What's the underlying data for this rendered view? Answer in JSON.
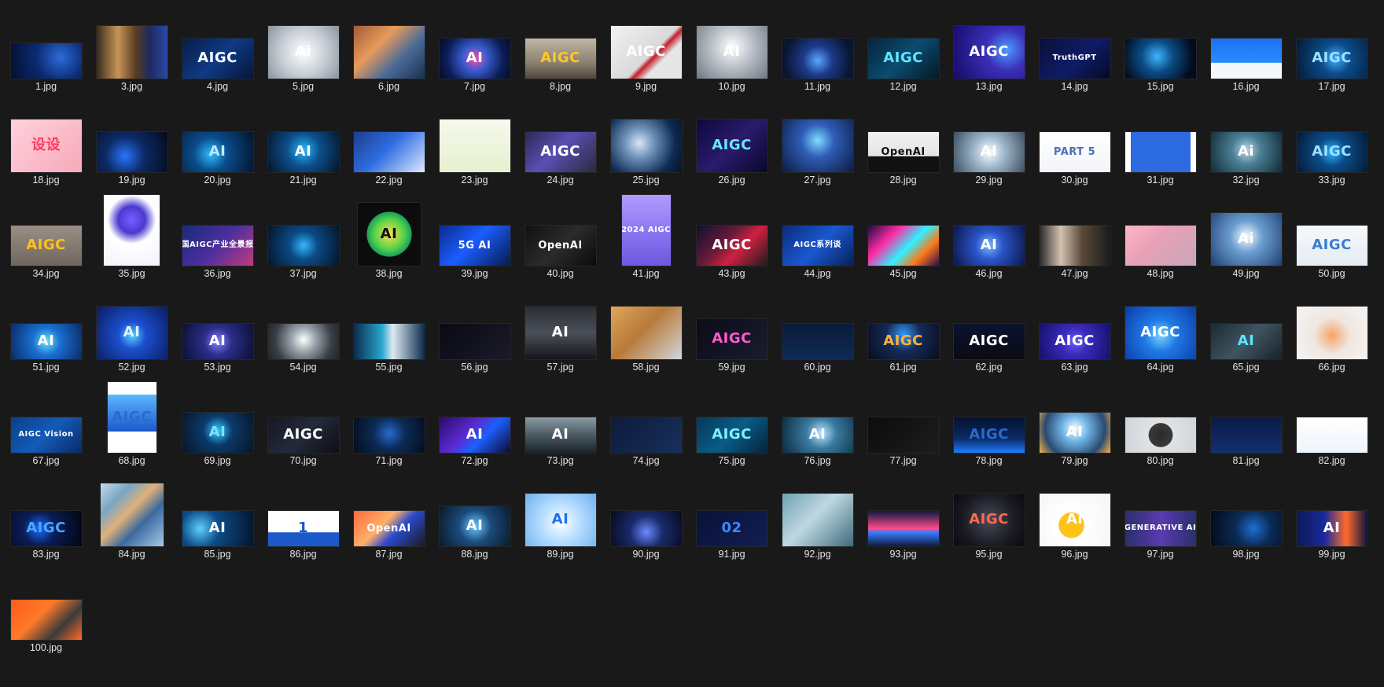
{
  "window": {
    "background": "#191919"
  },
  "tiles": [
    {
      "name": "1.jpg",
      "text": "",
      "fg": "#9cc4ff",
      "bg": "radial-gradient(circle at 70% 40%, #2c6cd9 0%, #0b2a72 45%, #03102e 100%)"
    },
    {
      "name": "3.jpg",
      "text": "",
      "fg": "#ffffff",
      "bg": "linear-gradient(90deg, #3a2a1a 0%, #c79558 30%, #5a3c22 55%, #1c2a5e 75%, #2b4aa8 100%)"
    },
    {
      "name": "4.jpg",
      "text": "AIGC",
      "fg": "#ffffff",
      "bg": "linear-gradient(135deg, #071c44 0%, #0f3a86 50%, #06163a 100%)"
    },
    {
      "name": "5.jpg",
      "text": "Ai",
      "fg": "#ffffff",
      "bg": "radial-gradient(circle at 50% 50%, #ffffff 0%, #c9cfd6 50%, #8a949e 100%)"
    },
    {
      "name": "6.jpg",
      "text": "",
      "fg": "#ffffff",
      "bg": "linear-gradient(135deg, #a45a3a 0%, #e79a5a 35%, #4a6a98 65%, #18304f 100%)"
    },
    {
      "name": "7.jpg",
      "text": "AI",
      "fg": "#ffffff",
      "bg": "radial-gradient(circle at 50% 50%, #ff4da6 0%, #3a5bd0 30%, #0a1d55 70%, #040c26 100%)"
    },
    {
      "name": "8.jpg",
      "text": "AIGC",
      "fg": "#ffc823",
      "bg": "linear-gradient(180deg, #bfb6a6 0%, #8c8170 60%, #4e463c 100%)"
    },
    {
      "name": "9.jpg",
      "text": "AIGC",
      "fg": "#ffffff",
      "bg": "linear-gradient(135deg, #f2f2f2 0%, #d9d9d9 55%, #c41e2a 60%, #e6e6e6 70%)"
    },
    {
      "name": "10.jpg",
      "text": "AI",
      "fg": "#ffffff",
      "bg": "radial-gradient(circle at 50% 40%, #ffffff 0%, #b8bec6 45%, #6e767f 100%)"
    },
    {
      "name": "11.jpg",
      "text": "",
      "fg": "#ffffff",
      "bg": "radial-gradient(circle at 50% 55%, #58a8ff 0%, #1d3a8a 35%, #0a1530 80%)"
    },
    {
      "name": "12.jpg",
      "text": "AIGC",
      "fg": "#5ee7ff",
      "bg": "linear-gradient(135deg, #06243c 0%, #0b4c70 50%, #041826 100%)"
    },
    {
      "name": "13.jpg",
      "text": "AIGC",
      "fg": "#ffffff",
      "bg": "radial-gradient(circle at 75% 45%, #4d9bff 0%, #3a2fb8 35%, #160a66 100%)"
    },
    {
      "name": "14.jpg",
      "text": "TruthGPT",
      "fg": "#ffffff",
      "bg": "linear-gradient(135deg, #0a0f3a 0%, #0e1c66 55%, #050a26 100%)"
    },
    {
      "name": "15.jpg",
      "text": "",
      "fg": "#ffffff",
      "bg": "radial-gradient(circle at 45% 45%, #3fb6ff 0%, #0b4c86 35%, #030c1e 80%)"
    },
    {
      "name": "16.jpg",
      "text": "",
      "fg": "#ffffff",
      "bg": "linear-gradient(180deg, #1d6ff2 0%, #2a8cff 60%, #f5f7fb 61%, #f5f7fb 100%)"
    },
    {
      "name": "17.jpg",
      "text": "AIGC",
      "fg": "#9fe0ff",
      "bg": "radial-gradient(circle at 55% 50%, #3fb0ff 0%, #0c4b8a 35%, #041a33 100%)"
    },
    {
      "name": "18.jpg",
      "text": "设设",
      "fg": "#ff3b5c",
      "bg": "linear-gradient(135deg, #ffd1dc 0%, #f7aabb 100%)"
    },
    {
      "name": "19.jpg",
      "text": "",
      "fg": "#ffffff",
      "bg": "radial-gradient(circle at 40% 60%, #2a74ff 0%, #0c2a66 40%, #040a1a 100%)"
    },
    {
      "name": "20.jpg",
      "text": "AI",
      "fg": "#bfe8ff",
      "bg": "radial-gradient(circle at 40% 55%, #2fbfff 0%, #0a4d8c 35%, #031329 100%)"
    },
    {
      "name": "21.jpg",
      "text": "AI",
      "fg": "#ffffff",
      "bg": "radial-gradient(circle at 50% 45%, #2bb6ff 0%, #0d4f8c 40%, #041427 100%)"
    },
    {
      "name": "22.jpg",
      "text": "",
      "fg": "#ffffff",
      "bg": "linear-gradient(135deg, #1d3d8f 0%, #2e6de0 45%, #dfe9ff 100%)"
    },
    {
      "name": "23.jpg",
      "text": "",
      "fg": "#333333",
      "bg": "linear-gradient(180deg, #f6f9ec 0%, #e6f0cf 100%)"
    },
    {
      "name": "24.jpg",
      "text": "AIGC",
      "fg": "#ffffff",
      "bg": "linear-gradient(135deg, #2b2a55 0%, #5a4fb3 45%, #2a2a3a 100%)"
    },
    {
      "name": "25.jpg",
      "text": "",
      "fg": "#ffffff",
      "bg": "radial-gradient(circle at 40% 45%, #d8e6f2 0%, #6b8fb6 30%, #0d2a52 70%, #061325 100%)"
    },
    {
      "name": "26.jpg",
      "text": "AIGC",
      "fg": "#68e6ff",
      "bg": "linear-gradient(135deg, #0b0a3a 0%, #2b1a6d 50%, #08082a 100%)"
    },
    {
      "name": "27.jpg",
      "text": "",
      "fg": "#ffffff",
      "bg": "radial-gradient(circle at 50% 40%, #7ddcff 0%, #2f5db8 35%, #0b1a3e 100%)"
    },
    {
      "name": "28.jpg",
      "text": "OpenAI",
      "fg": "#111111",
      "bg": "linear-gradient(180deg, #f2f2f2 0%, #e4e4e4 60%, #111111 61%, #111111 100%)"
    },
    {
      "name": "29.jpg",
      "text": "AI",
      "fg": "#ffffff",
      "bg": "radial-gradient(circle at 50% 50%, #ffffff 0%, #9ab4c8 40%, #3d4e5e 100%)"
    },
    {
      "name": "30.jpg",
      "text": "PART 5",
      "fg": "#4a6fb5",
      "bg": "linear-gradient(180deg, #ffffff 0%, #f2f4f8 100%)"
    },
    {
      "name": "31.jpg",
      "text": "",
      "fg": "#ffffff",
      "bg": "linear-gradient(90deg, #ffffff 0%, #ffffff 8%, #2c6be0 8%, #2c6be0 92%, #ffffff 92%, #ffffff 100%)"
    },
    {
      "name": "32.jpg",
      "text": "Ai",
      "fg": "#ffffff",
      "bg": "radial-gradient(circle at 50% 45%, #bcd7e6 0%, #4b7e93 35%, #0f2a36 100%)"
    },
    {
      "name": "33.jpg",
      "text": "AIGC",
      "fg": "#9fe0ff",
      "bg": "radial-gradient(circle at 50% 50%, #2fb6ff 0%, #0b4c8a 35%, #041a33 100%)"
    },
    {
      "name": "34.jpg",
      "text": "AIGC",
      "fg": "#ffc021",
      "bg": "linear-gradient(180deg, #9a8f84 0%, #6f665d 100%)"
    },
    {
      "name": "35.jpg",
      "text": "",
      "fg": "#ffffff",
      "bg": "radial-gradient(circle at 50% 35%, #7a5cff 0%, #4a3ad0 25%, #ffffff 45%, #f1f3fb 100%)"
    },
    {
      "name": "36.jpg",
      "text": "中国AIGC产业全景报告",
      "fg": "#ffffff",
      "bg": "linear-gradient(135deg, #1b2a7a 0%, #4a2f9e 50%, #c23a7e 100%)"
    },
    {
      "name": "37.jpg",
      "text": "",
      "fg": "#ffffff",
      "bg": "radial-gradient(circle at 50% 50%, #33b7ff 0%, #0b4b85 35%, #041427 100%)"
    },
    {
      "name": "38.jpg",
      "text": "AI",
      "fg": "#111111",
      "bg": "radial-gradient(circle at 50% 50%, #ffe24a 0%, #4fd04a 35%, #1c9e5a 50%, #0c0c0c 51%, #0c0c0c 100%)"
    },
    {
      "name": "39.jpg",
      "text": "5G AI",
      "fg": "#ffffff",
      "bg": "linear-gradient(135deg, #0a2a8a 0%, #1b5dff 45%, #061a4a 100%)"
    },
    {
      "name": "40.jpg",
      "text": "OpenAI",
      "fg": "#ffffff",
      "bg": "linear-gradient(135deg, #111111 0%, #2b2b2b 50%, #0b0b0b 100%)"
    },
    {
      "name": "41.jpg",
      "text": "2024 AIGC",
      "fg": "#ffffff",
      "bg": "linear-gradient(180deg, #b09cff 0%, #8a74f0 55%, #6d58e0 100%)"
    },
    {
      "name": "43.jpg",
      "text": "AIGC",
      "fg": "#ffffff",
      "bg": "linear-gradient(135deg, #0c1030 0%, #6b1a3a 40%, #d02040 60%, #1b1b1b 100%)"
    },
    {
      "name": "44.jpg",
      "text": "AIGC系列谈",
      "fg": "#ffffff",
      "bg": "linear-gradient(135deg, #0a2a7a 0%, #1a58d0 50%, #062058 100%)"
    },
    {
      "name": "45.jpg",
      "text": "",
      "fg": "#ffffff",
      "bg": "linear-gradient(135deg, #1a0a3a 0%, #ff2ba6 30%, #2ef2ff 55%, #ff7a1a 75%, #2a0a4a 100%)"
    },
    {
      "name": "46.jpg",
      "text": "AI",
      "fg": "#ffffff",
      "bg": "radial-gradient(circle at 50% 50%, #7ab7ff 0%, #2b54c8 35%, #0a1747 100%)"
    },
    {
      "name": "47.jpg",
      "text": "",
      "fg": "#ffffff",
      "bg": "linear-gradient(90deg, #2a2a2a 0%, #d4c2b0 30%, #5a4a3a 60%, #1a1a1a 100%)"
    },
    {
      "name": "48.jpg",
      "text": "",
      "fg": "#ffffff",
      "bg": "linear-gradient(135deg, #ffb5c7 0%, #e8a2b8 40%, #c8a6b8 100%)"
    },
    {
      "name": "49.jpg",
      "text": "Ai",
      "fg": "#ffffff",
      "bg": "radial-gradient(circle at 50% 45%, #ffffff 0%, #6c9ed0 35%, #1d3f73 100%)"
    },
    {
      "name": "50.jpg",
      "text": "AIGC",
      "fg": "#3a7dd0",
      "bg": "linear-gradient(180deg, #f6f8fb 0%, #e6ebf3 100%)"
    },
    {
      "name": "51.jpg",
      "text": "AI",
      "fg": "#ffffff",
      "bg": "radial-gradient(circle at 50% 50%, #6de2ff 0%, #1a6fd0 35%, #0a2a66 100%)"
    },
    {
      "name": "52.jpg",
      "text": "AI",
      "fg": "#dff6ff",
      "bg": "radial-gradient(circle at 50% 55%, #5ad2ff 0%, #1b4fd0 30%, #0a1a5a 100%)"
    },
    {
      "name": "53.jpg",
      "text": "AI",
      "fg": "#ffffff",
      "bg": "radial-gradient(circle at 50% 50%, #8a7dff 0%, #2a2f8a 35%, #0b0f33 100%)"
    },
    {
      "name": "54.jpg",
      "text": "",
      "fg": "#ffffff",
      "bg": "radial-gradient(circle at 50% 45%, #ffffff 0%, #9aa3ad 30%, #3a3f46 70%, #202326 100%)"
    },
    {
      "name": "55.jpg",
      "text": "",
      "fg": "#ffffff",
      "bg": "linear-gradient(90deg, #0a2a4a 0%, #2aa6d0 40%, #dfeaf2 55%, #0a2a4a 100%)"
    },
    {
      "name": "56.jpg",
      "text": "",
      "fg": "#ffffff",
      "bg": "linear-gradient(135deg, #0a0a14 0%, #1a1a2a 100%)"
    },
    {
      "name": "57.jpg",
      "text": "AI",
      "fg": "#ffffff",
      "bg": "linear-gradient(180deg, #2a2d33 0%, #4a4f58 50%, #15171a 100%)"
    },
    {
      "name": "58.jpg",
      "text": "",
      "fg": "#ffffff",
      "bg": "linear-gradient(135deg, #e0a65a 0%, #b87a3a 45%, #d2d6dc 100%)"
    },
    {
      "name": "59.jpg",
      "text": "AIGC",
      "fg": "#ff5ad0",
      "bg": "linear-gradient(135deg, #0b0c18 0%, #1a1c2f 100%)"
    },
    {
      "name": "60.jpg",
      "text": "",
      "fg": "#ffffff",
      "bg": "linear-gradient(180deg, #0a1b3a 0%, #0e2a55 100%)"
    },
    {
      "name": "61.jpg",
      "text": "AIGC",
      "fg": "#ffb13a",
      "bg": "radial-gradient(circle at 50% 30%, #2f9bff 0%, #142a55 40%, #090d1a 100%)"
    },
    {
      "name": "62.jpg",
      "text": "AIGC",
      "fg": "#ffffff",
      "bg": "linear-gradient(180deg, #0a1230 0%, #0a0a12 100%)"
    },
    {
      "name": "63.jpg",
      "text": "AIGC",
      "fg": "#ffffff",
      "bg": "radial-gradient(circle at 50% 50%, #6a5cff 0%, #3a2ab8 35%, #14106a 100%)"
    },
    {
      "name": "64.jpg",
      "text": "AIGC",
      "fg": "#ffffff",
      "bg": "radial-gradient(circle at 50% 55%, #7ad4ff 0%, #1f7ae6 35%, #0a3aa6 100%)"
    },
    {
      "name": "65.jpg",
      "text": "AI",
      "fg": "#5fe3ff",
      "bg": "linear-gradient(135deg, #1b2a33 0%, #3f5561 50%, #182128 100%)"
    },
    {
      "name": "66.jpg",
      "text": "",
      "fg": "#ffffff",
      "bg": "radial-gradient(circle at 50% 55%, #f5a46a 0%, #efe7e0 40%, #f5f5f5 100%)"
    },
    {
      "name": "67.jpg",
      "text": "AIGC Vision",
      "fg": "#ffffff",
      "bg": "linear-gradient(135deg, #0b3f8a 0%, #135bb8 50%, #0a2b66 100%)"
    },
    {
      "name": "68.jpg",
      "text": "AIGC",
      "fg": "#2a6ad0",
      "bg": "linear-gradient(180deg, #ffffff 0%, #ffffff 18%, #5ab6ff 18%, #1d58c9 70%, #ffffff 70%, #ffffff 100%)"
    },
    {
      "name": "69.jpg",
      "text": "AI",
      "fg": "#7fe0ff",
      "bg": "radial-gradient(circle at 50% 45%, #2fd0ff 0%, #0b3a6a 35%, #071524 100%)"
    },
    {
      "name": "70.jpg",
      "text": "AIGC",
      "fg": "#ffffff",
      "bg": "linear-gradient(135deg, #151823 0%, #242a3a 50%, #0d0f16 100%)"
    },
    {
      "name": "71.jpg",
      "text": "",
      "fg": "#ffffff",
      "bg": "radial-gradient(circle at 50% 45%, #2a6ad0 0%, #0b2a55 40%, #050d1c 100%)"
    },
    {
      "name": "72.jpg",
      "text": "AI",
      "fg": "#ffffff",
      "bg": "linear-gradient(135deg, #2a0a6a 0%, #5a2ad0 40%, #1a60ff 60%, #12082a 100%)"
    },
    {
      "name": "73.jpg",
      "text": "AI",
      "fg": "#ffffff",
      "bg": "linear-gradient(180deg, #8b9aa3 0%, #4a5a62 50%, #1a2428 100%)"
    },
    {
      "name": "74.jpg",
      "text": "",
      "fg": "#ffffff",
      "bg": "linear-gradient(135deg, #0e1a3a 0%, #17305c 100%)"
    },
    {
      "name": "75.jpg",
      "text": "AIGC",
      "fg": "#7ff0ff",
      "bg": "linear-gradient(135deg, #063a5a 0%, #0a5c86 50%, #04233a 100%)"
    },
    {
      "name": "76.jpg",
      "text": "AI",
      "fg": "#ffffff",
      "bg": "radial-gradient(circle at 55% 45%, #bfe8ff 0%, #3a7aa0 35%, #0b2a3d 100%)"
    },
    {
      "name": "77.jpg",
      "text": "",
      "fg": "#ffffff",
      "bg": "linear-gradient(135deg, #0c0c0c 0%, #1d1d1d 100%)"
    },
    {
      "name": "78.jpg",
      "text": "AIGC",
      "fg": "#2a6ad0",
      "bg": "linear-gradient(180deg, #04122e 0%, #0a2a66 60%, #1e7cff 100%)"
    },
    {
      "name": "79.jpg",
      "text": "AI",
      "fg": "#ffffff",
      "bg": "radial-gradient(circle at 50% 40%, #ffffff 0%, #6fb5e6 30%, #2a4a70 70%, #ffb04a 100%)"
    },
    {
      "name": "80.jpg",
      "text": "",
      "fg": "#ffffff",
      "bg": "radial-gradient(circle at 50% 50%, #2a2a2a 0%, #3a3a3a 30%, #dfe3e6 31%, #cfd4d8 100%)"
    },
    {
      "name": "81.jpg",
      "text": "",
      "fg": "#ffffff",
      "bg": "linear-gradient(180deg, #0a1a44 0%, #123070 100%)"
    },
    {
      "name": "82.jpg",
      "text": "",
      "fg": "#333333",
      "bg": "linear-gradient(180deg, #ffffff 0%, #eef4fb 100%)"
    },
    {
      "name": "83.jpg",
      "text": "AIGC",
      "fg": "#4aa8ff",
      "bg": "radial-gradient(circle at 40% 50%, #1b6cff 0%, #0a1d55 35%, #030510 100%)"
    },
    {
      "name": "84.jpg",
      "text": "",
      "fg": "#ffffff",
      "bg": "linear-gradient(135deg, #c7d9e6 0%, #7aa6c6 25%, #e0b07a 45%, #3a6aa0 65%, #a8c8e6 100%)"
    },
    {
      "name": "85.jpg",
      "text": "AI",
      "fg": "#ffffff",
      "bg": "radial-gradient(circle at 25% 50%, #5fd0ff 0%, #0b4a86 35%, #031429 100%)"
    },
    {
      "name": "86.jpg",
      "text": "1",
      "fg": "#1d58c9",
      "bg": "linear-gradient(180deg, #ffffff 0%, #ffffff 60%, #1d58c9 61%, #1d58c9 100%)"
    },
    {
      "name": "87.jpg",
      "text": "OpenAI",
      "fg": "#ffffff",
      "bg": "linear-gradient(135deg, #ff6a3a 0%, #ffb06a 40%, #2a4ad0 60%, #1a1a1a 100%)"
    },
    {
      "name": "88.jpg",
      "text": "AI",
      "fg": "#ffffff",
      "bg": "radial-gradient(circle at 50% 50%, #6ac8ff 0%, #1b4a7a 40%, #0a1a2a 100%)"
    },
    {
      "name": "89.jpg",
      "text": "AI",
      "fg": "#1d6ff2",
      "bg": "radial-gradient(circle at 50% 55%, #ffffff 0%, #b9e0ff 40%, #6fb0f0 100%)"
    },
    {
      "name": "90.jpg",
      "text": "",
      "fg": "#ffffff",
      "bg": "radial-gradient(circle at 50% 60%, #6a8aff 0%, #1a2a6a 40%, #050a1e 100%)"
    },
    {
      "name": "91.jpg",
      "text": "02",
      "fg": "#3a8aff",
      "bg": "linear-gradient(135deg, #0a1238 0%, #121e52 100%)"
    },
    {
      "name": "92.jpg",
      "text": "",
      "fg": "#ffffff",
      "bg": "linear-gradient(135deg, #6fa3b5 0%, #bfd8e0 45%, #3d6a7a 100%)"
    },
    {
      "name": "93.jpg",
      "text": "",
      "fg": "#ffffff",
      "bg": "linear-gradient(180deg, #0d1a3d 0%, #ff4a8a 50%, #3a7dff 60%, #0d1a3d 100%)"
    },
    {
      "name": "95.jpg",
      "text": "AIGC",
      "fg": "#ff6a4a",
      "bg": "radial-gradient(circle at 50% 50%, #4a4a5a 0%, #1a1a22 60%, #0a0a0e 100%)"
    },
    {
      "name": "96.jpg",
      "text": "Ai",
      "fg": "#ffffff",
      "bg": "radial-gradient(circle at 45% 60%, #ffc21a 0%, #ffc21a 25%, #ffffff 26%, #f4f4f4 100%)"
    },
    {
      "name": "97.jpg",
      "text": "GENERATIVE AI",
      "fg": "#ffffff",
      "bg": "linear-gradient(90deg, #2a2f6a 0%, #5a3ab0 50%, #2a2f6a 100%)"
    },
    {
      "name": "98.jpg",
      "text": "",
      "fg": "#ffffff",
      "bg": "radial-gradient(circle at 60% 50%, #1f6fd0 0%, #0a2a55 40%, #040a18 100%)"
    },
    {
      "name": "99.jpg",
      "text": "AI",
      "fg": "#ffffff",
      "bg": "linear-gradient(90deg, #0a1a55 0%, #1b2a9e 40%, #ff6a2a 70%, #0a1240 100%)"
    },
    {
      "name": "100.jpg",
      "text": "",
      "fg": "#ffffff",
      "bg": "linear-gradient(135deg, #ff5a1a 0%, #ff7a2a 40%, #3a3a3a 70%, #ff6a2a 100%)"
    }
  ]
}
